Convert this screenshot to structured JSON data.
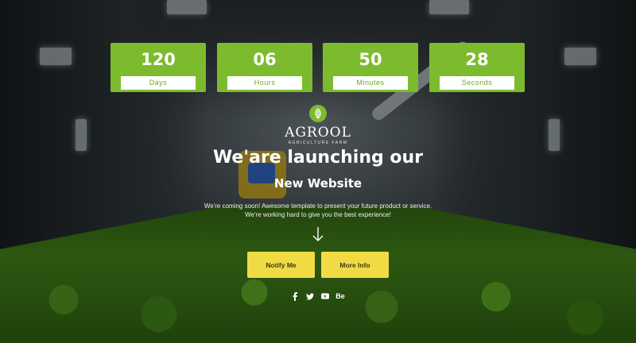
{
  "countdown": [
    {
      "value": "120",
      "label": "Days"
    },
    {
      "value": "06",
      "label": "Hours"
    },
    {
      "value": "50",
      "label": "Minutes"
    },
    {
      "value": "28",
      "label": "Seconds"
    }
  ],
  "logo": {
    "name": "AGROOL",
    "tagline": "AGRICULTURE FARM",
    "icon": "leaf-icon"
  },
  "headline": "We'are launching our",
  "subheadline": "New Website",
  "description": [
    "We're coming soon! Awesome template to present your future product or service.",
    "We're working hard to give you the best experience!"
  ],
  "buttons": {
    "notify": "Notify Me",
    "more_info": "More Info"
  },
  "social": [
    "facebook-icon",
    "twitter-icon",
    "youtube-icon",
    "behance-icon"
  ],
  "social_text": {
    "behance": "Be"
  },
  "colors": {
    "accent_green": "#7dbb2e",
    "button_yellow": "#f1db45",
    "label_green_text": "#6aa824"
  }
}
